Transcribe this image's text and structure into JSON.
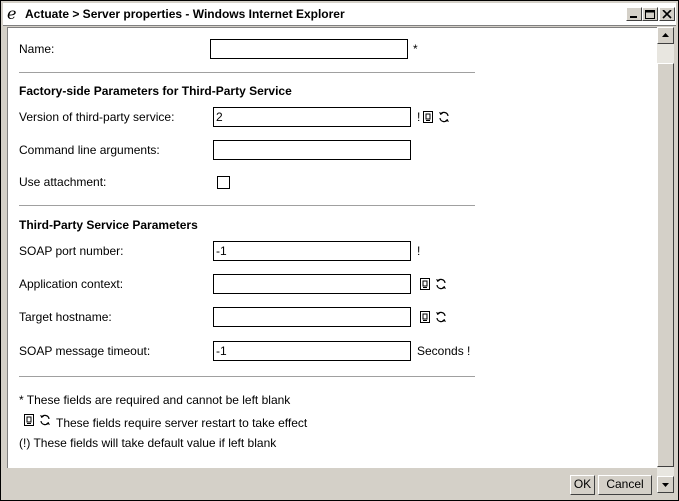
{
  "window": {
    "title": "Actuate > Server properties - Windows Internet Explorer",
    "minimize_label": "",
    "maximize_label": "",
    "close_label": ""
  },
  "form": {
    "name_label": "Name:",
    "name_value": "",
    "required_mark": "*",
    "section1_title": "Factory-side Parameters for Third-Party Service",
    "version_label": "Version of third-party service:",
    "version_value": "2",
    "version_flag": "!",
    "cmdline_label": "Command line arguments:",
    "cmdline_value": "",
    "attachment_label": "Use attachment:",
    "attachment_checked": false,
    "section2_title": "Third-Party Service Parameters",
    "soap_port_label": "SOAP port number:",
    "soap_port_value": "-1",
    "soap_port_flag": "!",
    "app_context_label": "Application context:",
    "app_context_value": "",
    "target_host_label": "Target hostname:",
    "target_host_value": "",
    "timeout_label": "SOAP message timeout:",
    "timeout_value": "-1",
    "timeout_unit": "Seconds !"
  },
  "legend": {
    "required_note": "* These fields are required and cannot be left blank",
    "restart_note": "These fields require server restart to take effect",
    "default_note": "(!) These fields will take default value if left blank"
  },
  "buttons": {
    "ok": "OK",
    "cancel": "Cancel"
  },
  "icons": {
    "restart_icon": "server-restart-icon",
    "refresh_icon": "refresh-icon"
  }
}
